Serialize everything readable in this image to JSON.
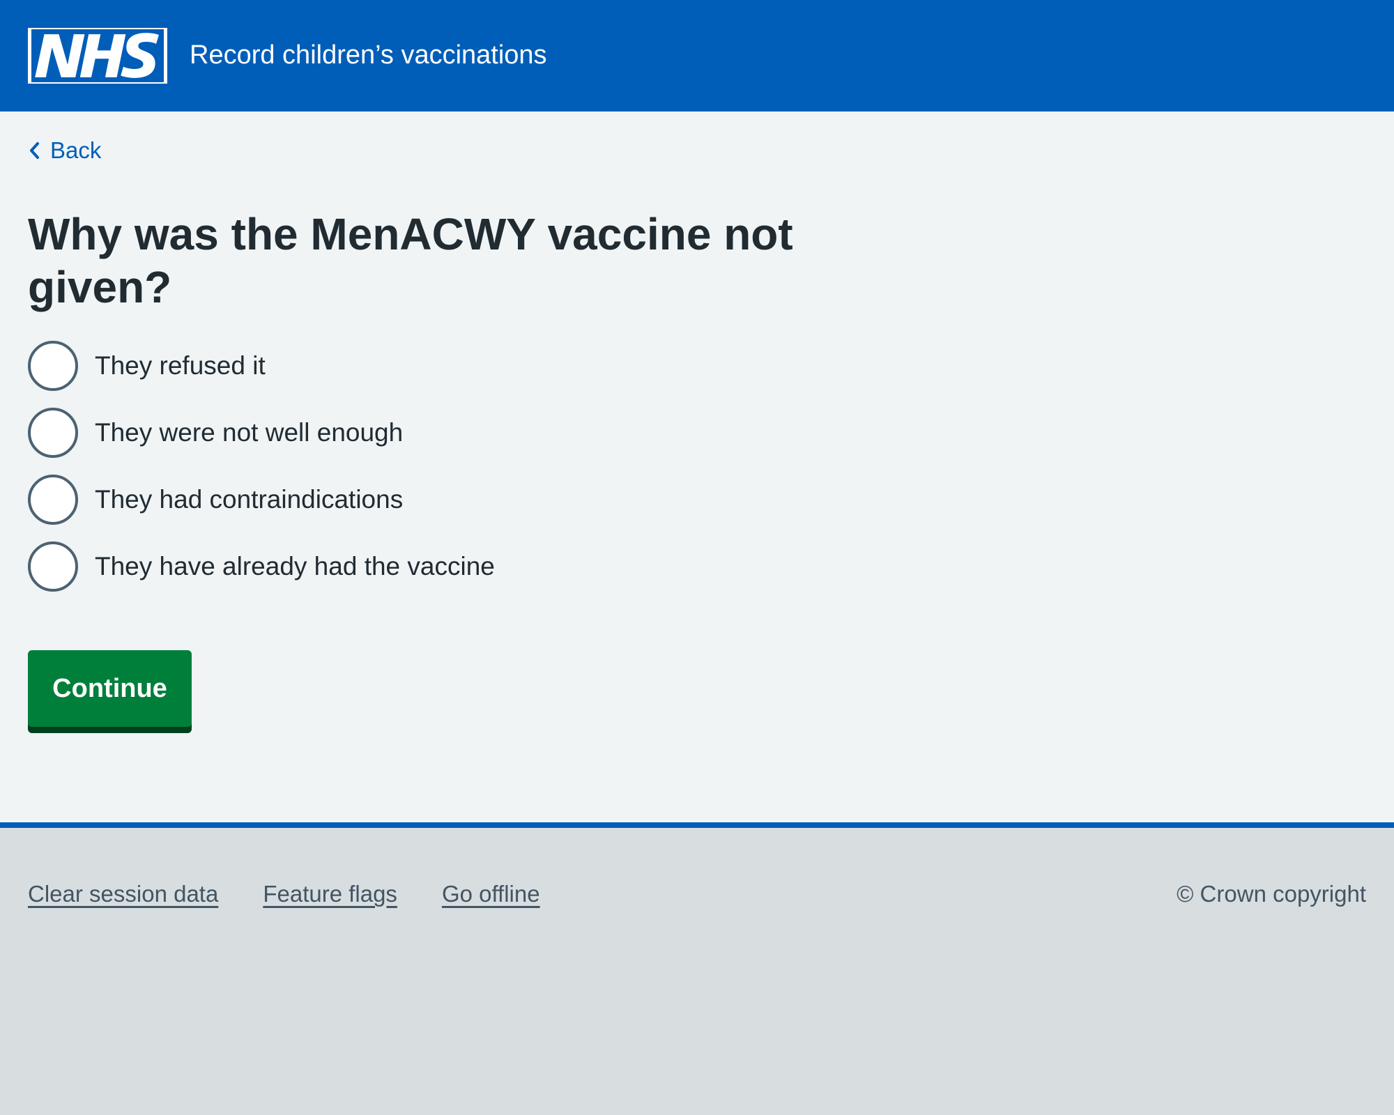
{
  "header": {
    "logo_text": "NHS",
    "service_name": "Record children’s vaccinations",
    "background_color": "#005eb8"
  },
  "back_link": {
    "label": "Back",
    "icon": "chevron-left-icon"
  },
  "page": {
    "title": "Why was the MenACWY vaccine not given?"
  },
  "radios": {
    "options": [
      {
        "label": "They refused it",
        "selected": false
      },
      {
        "label": "They were not well enough",
        "selected": false
      },
      {
        "label": "They had contraindications",
        "selected": false
      },
      {
        "label": "They have already had the vaccine",
        "selected": false
      }
    ]
  },
  "actions": {
    "continue_label": "Continue",
    "continue_color": "#007f3b"
  },
  "footer": {
    "links": [
      {
        "label": "Clear session data"
      },
      {
        "label": "Feature flags"
      },
      {
        "label": "Go offline"
      }
    ],
    "copyright": "© Crown copyright"
  }
}
